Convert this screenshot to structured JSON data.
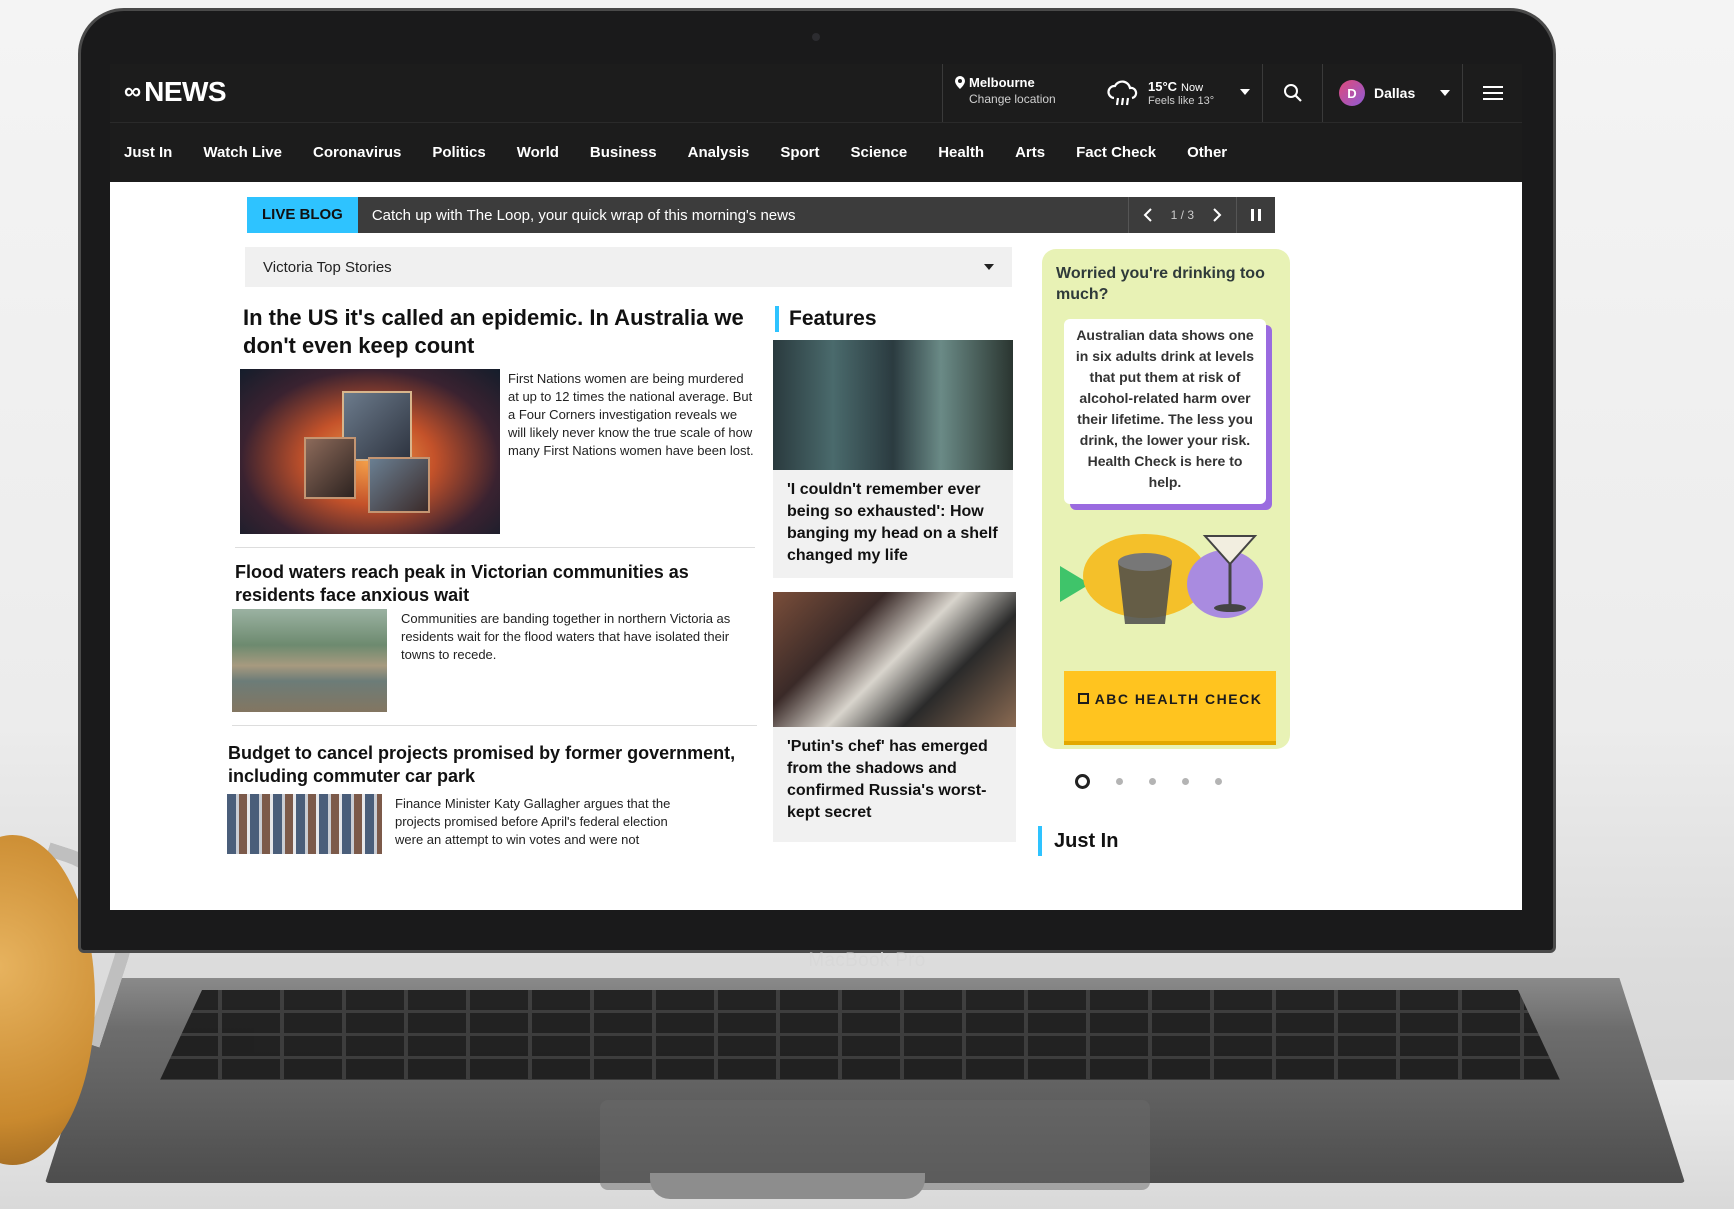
{
  "laptop": {
    "brand_label": "MacBook Pro"
  },
  "header": {
    "logo_text": "NEWS",
    "location": {
      "city": "Melbourne",
      "change_label": "Change location"
    },
    "weather": {
      "temp": "15°C",
      "now_label": "Now",
      "feels_like": "Feels like 13°"
    },
    "user": {
      "initial": "D",
      "name": "Dallas"
    }
  },
  "nav": {
    "items": [
      "Just In",
      "Watch Live",
      "Coronavirus",
      "Politics",
      "World",
      "Business",
      "Analysis",
      "Sport",
      "Science",
      "Health",
      "Arts",
      "Fact Check",
      "Other"
    ]
  },
  "liveblog": {
    "tag": "LIVE BLOG",
    "text": "Catch up with The Loop, your quick wrap of this morning's news",
    "counter": "1 / 3"
  },
  "topstories": {
    "selected": "Victoria Top Stories"
  },
  "stories": [
    {
      "title": "In the US it's called an epidemic. In Australia we don't even keep count",
      "summary": "First Nations women are being murdered at up to 12 times the national average. But a Four Corners investigation reveals we will likely never know the true scale of how many First Nations women have been lost."
    },
    {
      "title": "Flood waters reach peak in Victorian communities as residents face anxious wait",
      "summary": "Communities are banding together in northern Victoria as residents wait for the flood waters that have isolated their towns to recede."
    },
    {
      "title": "Budget to cancel projects promised by former government, including commuter car park",
      "summary": "Finance Minister Katy Gallagher argues that the projects promised before April's federal election were an attempt to win votes and were not"
    }
  ],
  "features": {
    "heading": "Features",
    "cards": [
      {
        "title": "'I couldn't remember ever being so exhausted': How banging my head on a shelf changed my life"
      },
      {
        "title": "'Putin's chef' has emerged from the shadows and confirmed Russia's worst-kept secret"
      }
    ]
  },
  "promo": {
    "question": "Worried you're drinking too much?",
    "body": "Australian data shows one in six adults drink at levels that put them at risk of alcohol-related harm over their lifetime. The less you drink, the lower your risk. Health Check is here to help.",
    "button": "ABC HEALTH CHECK",
    "carousel": {
      "total": 5,
      "active": 1
    }
  },
  "justin": {
    "heading": "Just In"
  },
  "colors": {
    "accent_blue": "#2ec3ff",
    "promo_bg": "#e8f2b5",
    "promo_button": "#ffc41f",
    "promo_shadow": "#9a6be0",
    "header_bg": "#1c1c1c"
  },
  "icons": [
    "location-pin-icon",
    "rain-cloud-icon",
    "search-icon",
    "hamburger-menu-icon",
    "chevron-left-icon",
    "chevron-right-icon",
    "pause-icon",
    "external-link-icon",
    "chevron-down-icon"
  ]
}
